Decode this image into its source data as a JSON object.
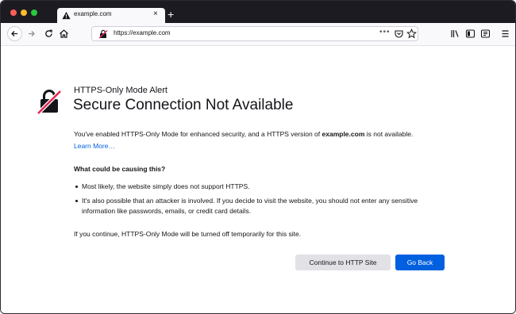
{
  "tab": {
    "title": "example.com",
    "close": "×"
  },
  "newtab_label": "+",
  "url": {
    "text": "https://example.com",
    "menu_dots": "•••"
  },
  "alert": {
    "small_title": "HTTPS-Only Mode Alert",
    "title": "Secure Connection Not Available",
    "desc_before": "You've enabled HTTPS-Only Mode for enhanced security, and a HTTPS version of ",
    "desc_domain": "example.com",
    "desc_after": " is not available.",
    "learn_more": "Learn More…",
    "cause_heading": "What could be causing this?",
    "bullets": [
      "Most likely, the website simply does not support HTTPS.",
      "It's also possible that an attacker is involved. If you decide to visit the website, you should not enter any sensitive information like passwords, emails, or credit card details."
    ],
    "footer": "If you continue, HTTPS-Only Mode will be turned off temporarily for this site.",
    "continue_label": "Continue to HTTP Site",
    "back_label": "Go Back"
  },
  "colors": {
    "accent": "#0060df",
    "titlebar": "#1c1b22",
    "warn_red": "#e22850"
  },
  "icons": [
    "warning-icon",
    "back-icon",
    "forward-icon",
    "reload-icon",
    "home-icon",
    "insecure-lock-icon",
    "pocket-icon",
    "bookmark-star-icon",
    "library-icon",
    "sidebar-icon",
    "extensions-icon",
    "menu-icon",
    "broken-lock-icon"
  ]
}
